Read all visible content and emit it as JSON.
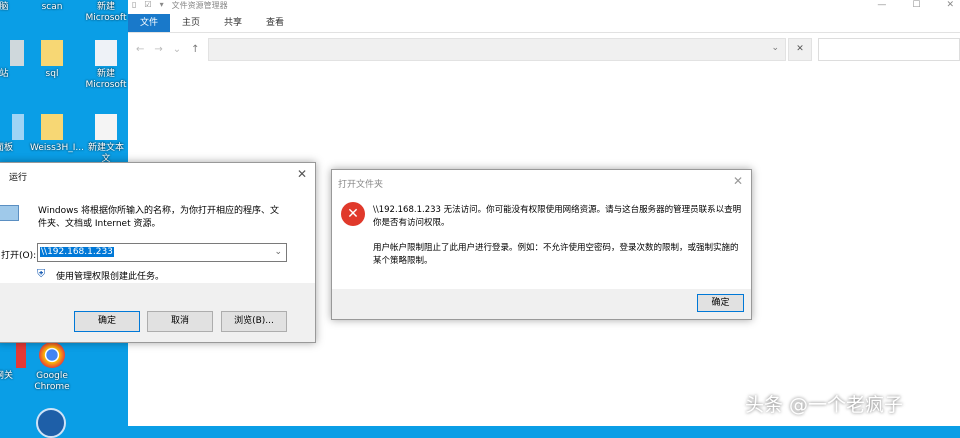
{
  "desktop": {
    "icons": [
      {
        "label": "脑"
      },
      {
        "label": "scan"
      },
      {
        "label": "新建 Microsoft"
      },
      {
        "label": "站"
      },
      {
        "label": "sql"
      },
      {
        "label": "新建 Microsoft"
      },
      {
        "label": "面板"
      },
      {
        "label": "Weiss3H_I..."
      },
      {
        "label": "新建文本文"
      },
      {
        "label": "网关"
      },
      {
        "label": "Google Chrome"
      }
    ]
  },
  "explorer": {
    "title": "文件资源管理器",
    "tabs": [
      "文件",
      "主页",
      "共享",
      "查看"
    ]
  },
  "run": {
    "title": "运行",
    "desc": "Windows 将根据你所输入的名称，为你打开相应的程序、文件夹、文档或 Internet 资源。",
    "open_label": "打开(O):",
    "open_value": "\\\\192.168.1.233",
    "admin": "使用管理权限创建此任务。",
    "ok": "确定",
    "cancel": "取消",
    "browse": "浏览(B)..."
  },
  "error": {
    "title": "打开文件夹",
    "msg1": "\\\\192.168.1.233 无法访问。你可能没有权限使用网络资源。请与这台服务器的管理员联系以查明你是否有访问权限。",
    "msg2": "用户帐户限制阻止了此用户进行登录。例如：不允许使用空密码，登录次数的限制，或强制实施的某个策略限制。",
    "ok": "确定"
  },
  "watermark": "头条 @一个老疯子"
}
